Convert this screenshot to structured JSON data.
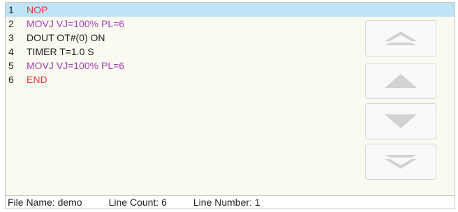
{
  "colors": {
    "selected_bg": "#bfe4f5",
    "keyword_red": "#e03a3a",
    "motion_purple": "#a040b8",
    "text_dark": "#222222",
    "editor_bg": "#fafaf0",
    "arrow_gray": "#d2d2d2"
  },
  "program": {
    "lines": [
      {
        "number": "1",
        "text": "NOP",
        "color": "#e03a3a",
        "selected": true
      },
      {
        "number": "2",
        "text": "MOVJ VJ=100% PL=6",
        "color": "#a040b8",
        "selected": false
      },
      {
        "number": "3",
        "text": "DOUT OT#(0) ON",
        "color": "#222222",
        "selected": false
      },
      {
        "number": "4",
        "text": "TIMER T=1.0 S",
        "color": "#222222",
        "selected": false
      },
      {
        "number": "5",
        "text": "MOVJ VJ=100% PL=6",
        "color": "#a040b8",
        "selected": false
      },
      {
        "number": "6",
        "text": "END",
        "color": "#e03a3a",
        "selected": false
      }
    ]
  },
  "nav_buttons": [
    {
      "name": "page-up-button",
      "icon": "double-chevron-up-icon"
    },
    {
      "name": "line-up-button",
      "icon": "triangle-up-icon"
    },
    {
      "name": "line-down-button",
      "icon": "triangle-down-icon"
    },
    {
      "name": "page-down-button",
      "icon": "double-chevron-down-icon"
    }
  ],
  "status": {
    "file_name": "File Name: demo",
    "line_count": "Line Count: 6",
    "line_number": "Line Number: 1"
  }
}
